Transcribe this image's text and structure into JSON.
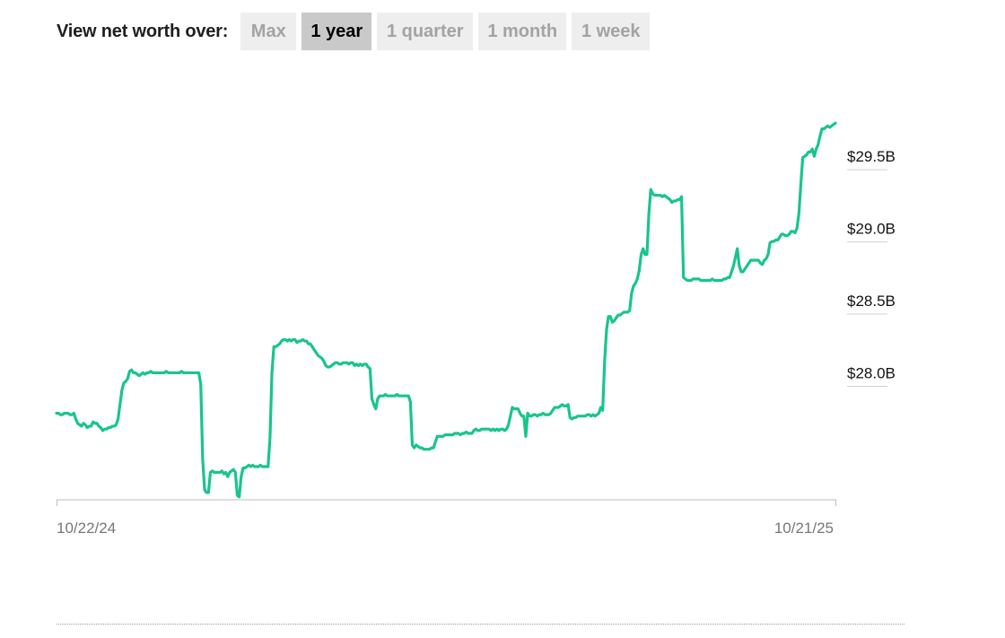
{
  "toolbar": {
    "label": "View net worth over:",
    "ranges": [
      "Max",
      "1 year",
      "1 quarter",
      "1 month",
      "1 week"
    ],
    "active_range": "1 year"
  },
  "colors": {
    "line": "#19c58a",
    "axis": "#bdbdbd",
    "active_bg": "#c9c9c9",
    "inactive_bg": "#eeeeee"
  },
  "chart_data": {
    "type": "line",
    "xlabel": "",
    "ylabel": "",
    "x_ticks": [
      "10/22/24",
      "10/21/25"
    ],
    "y_ticks": [
      "$28.0B",
      "$28.5B",
      "$29.0B",
      "$29.5B"
    ],
    "y_tick_values": [
      28.0,
      28.5,
      29.0,
      29.5
    ],
    "ylim": [
      27.12,
      29.93
    ],
    "y_unit": "billions USD",
    "series": [
      {
        "values": [
          27.72,
          27.72,
          27.71,
          27.71,
          27.72,
          27.72,
          27.72,
          27.71,
          27.71,
          27.72,
          27.68,
          27.65,
          27.64,
          27.63,
          27.65,
          27.64,
          27.62,
          27.63,
          27.63,
          27.66,
          27.65,
          27.65,
          27.63,
          27.62,
          27.6,
          27.61,
          27.61,
          27.62,
          27.62,
          27.63,
          27.63,
          27.64,
          27.68,
          27.78,
          27.88,
          27.93,
          27.94,
          27.96,
          28.01,
          28.02,
          28.0,
          28.0,
          27.99,
          27.98,
          27.99,
          28.0,
          27.99,
          28.0,
          28.0,
          28.01,
          28.0,
          28.0,
          28.0,
          28.0,
          28.0,
          28.0,
          28.0,
          28.01,
          28.0,
          28.0,
          28.0,
          28.0,
          28.0,
          28.0,
          28.0,
          28.01,
          28.0,
          28.0,
          28.0,
          28.0,
          28.0,
          28.0,
          28.0,
          28.0,
          28.0,
          27.92,
          27.4,
          27.19,
          27.17,
          27.17,
          27.31,
          27.32,
          27.31,
          27.31,
          27.31,
          27.31,
          27.32,
          27.3,
          27.31,
          27.28,
          27.31,
          27.32,
          27.33,
          27.31,
          27.15,
          27.14,
          27.28,
          27.34,
          27.34,
          27.35,
          27.36,
          27.35,
          27.36,
          27.35,
          27.35,
          27.35,
          27.36,
          27.35,
          27.35,
          27.35,
          27.35,
          27.55,
          28.0,
          28.18,
          28.18,
          28.19,
          28.2,
          28.22,
          28.23,
          28.23,
          28.22,
          28.23,
          28.22,
          28.23,
          28.23,
          28.21,
          28.22,
          28.22,
          28.23,
          28.22,
          28.22,
          28.2,
          28.2,
          28.18,
          28.16,
          28.14,
          28.12,
          28.11,
          28.1,
          28.08,
          28.05,
          28.04,
          28.04,
          28.05,
          28.06,
          28.07,
          28.07,
          28.06,
          28.06,
          28.07,
          28.07,
          28.07,
          28.06,
          28.07,
          28.07,
          28.05,
          28.06,
          28.05,
          28.06,
          28.05,
          28.06,
          28.06,
          28.04,
          28.03,
          27.82,
          27.78,
          27.75,
          27.82,
          27.84,
          27.84,
          27.84,
          27.85,
          27.84,
          27.84,
          27.84,
          27.84,
          27.84,
          27.85,
          27.84,
          27.84,
          27.84,
          27.84,
          27.84,
          27.84,
          27.8,
          27.5,
          27.48,
          27.5,
          27.49,
          27.48,
          27.48,
          27.47,
          27.47,
          27.47,
          27.47,
          27.48,
          27.48,
          27.52,
          27.56,
          27.56,
          27.56,
          27.56,
          27.57,
          27.57,
          27.57,
          27.57,
          27.57,
          27.58,
          27.58,
          27.58,
          27.57,
          27.58,
          27.58,
          27.59,
          27.58,
          27.58,
          27.58,
          27.6,
          27.61,
          27.6,
          27.6,
          27.61,
          27.61,
          27.61,
          27.61,
          27.61,
          27.6,
          27.61,
          27.6,
          27.61,
          27.6,
          27.61,
          27.61,
          27.6,
          27.61,
          27.64,
          27.7,
          27.76,
          27.75,
          27.75,
          27.75,
          27.72,
          27.7,
          27.7,
          27.56,
          27.72,
          27.7,
          27.7,
          27.71,
          27.71,
          27.7,
          27.71,
          27.71,
          27.72,
          27.71,
          27.71,
          27.71,
          27.72,
          27.74,
          27.76,
          27.76,
          27.76,
          27.77,
          27.78,
          27.77,
          27.77,
          27.78,
          27.69,
          27.68,
          27.69,
          27.69,
          27.7,
          27.7,
          27.7,
          27.7,
          27.7,
          27.71,
          27.71,
          27.7,
          27.71,
          27.7,
          27.71,
          27.72,
          27.76,
          27.74,
          28.08,
          28.3,
          28.39,
          28.39,
          28.35,
          28.36,
          28.38,
          28.4,
          28.4,
          28.41,
          28.42,
          28.42,
          28.42,
          28.43,
          28.55,
          28.6,
          28.62,
          28.65,
          28.71,
          28.82,
          28.86,
          28.82,
          28.82,
          29.1,
          29.27,
          29.24,
          29.23,
          29.23,
          29.23,
          29.23,
          29.22,
          29.23,
          29.22,
          29.21,
          29.2,
          29.18,
          29.19,
          29.19,
          29.2,
          29.2,
          29.22,
          28.66,
          28.65,
          28.64,
          28.64,
          28.64,
          28.65,
          28.65,
          28.65,
          28.65,
          28.64,
          28.64,
          28.64,
          28.64,
          28.64,
          28.64,
          28.65,
          28.64,
          28.64,
          28.64,
          28.64,
          28.64,
          28.65,
          28.65,
          28.66,
          28.66,
          28.7,
          28.74,
          28.8,
          28.86,
          28.74,
          28.7,
          28.7,
          28.72,
          28.74,
          28.76,
          28.78,
          28.78,
          28.78,
          28.78,
          28.78,
          28.76,
          28.75,
          28.78,
          28.79,
          28.82,
          28.9,
          28.91,
          28.91,
          28.92,
          28.92,
          28.94,
          28.96,
          28.96,
          28.95,
          28.95,
          28.96,
          28.98,
          28.98,
          28.97,
          29.0,
          29.1,
          29.3,
          29.49,
          29.5,
          29.51,
          29.53,
          29.53,
          29.55,
          29.5,
          29.55,
          29.58,
          29.64,
          29.69,
          29.69,
          29.7,
          29.71,
          29.7,
          29.71,
          29.72,
          29.73
        ]
      }
    ],
    "grid": false,
    "legend": "none"
  }
}
